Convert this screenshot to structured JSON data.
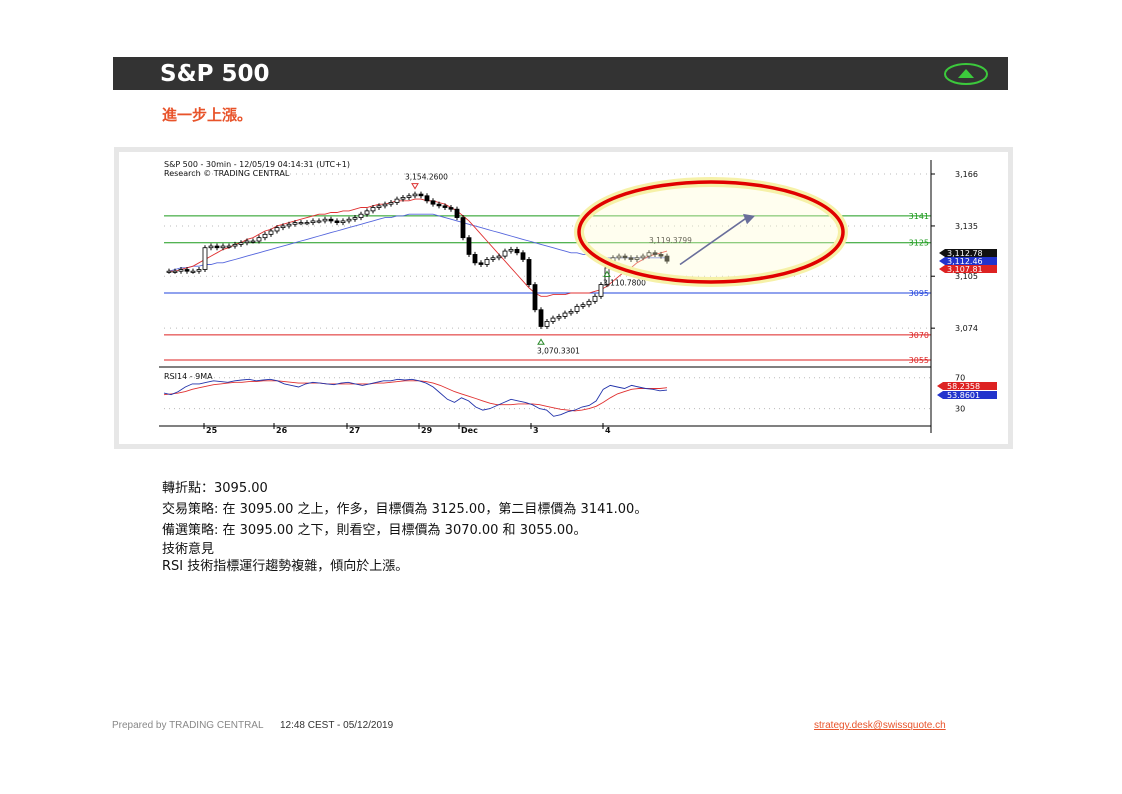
{
  "header": {
    "title": "S&P 500",
    "trend_icon": "up-triangle-icon"
  },
  "subtitle": "進一步上漲。",
  "chart_data": {
    "type": "candlestick",
    "title": "S&P 500 - 30min - 12/05/19 04:14:31 (UTC+1)",
    "subtitle": "Research © TRADING CENTRAL",
    "ylim": [
      3055,
      3166
    ],
    "y_ticks": [
      3166,
      3135,
      3105,
      3074
    ],
    "y_tick_labels": [
      "3,166",
      "3,135",
      "3,105",
      "3,074"
    ],
    "x_tick_labels": [
      "25",
      "26",
      "27",
      "29",
      "Dec",
      "3",
      "4"
    ],
    "levels": [
      {
        "label": "3141",
        "value": 3141,
        "color": "#1a9a1a"
      },
      {
        "label": "3125",
        "value": 3125,
        "color": "#1a9a1a"
      },
      {
        "label": "3095",
        "value": 3095,
        "color": "#2244dd"
      },
      {
        "label": "3070",
        "value": 3070,
        "color": "#dd2222"
      },
      {
        "label": "3055",
        "value": 3055,
        "color": "#dd2222"
      }
    ],
    "annotations": [
      {
        "text": "3,154.2600",
        "value": 3154.26
      },
      {
        "text": "3,110.7800",
        "value": 3110.78
      },
      {
        "text": "3,070.3301",
        "value": 3070.33
      },
      {
        "text": "3,119.3799",
        "value": 3119.38
      }
    ],
    "price_tags": [
      {
        "text": "3,112.78",
        "value": 3112.78,
        "color": "#111111"
      },
      {
        "text": "3,112.46",
        "value": 3112.46,
        "color": "#2233cc"
      },
      {
        "text": "3,107.81",
        "value": 3107.81,
        "color": "#dd2222"
      }
    ],
    "closes": [
      3108,
      3108,
      3109,
      3108,
      3108,
      3109,
      3122,
      3123,
      3122,
      3123,
      3123,
      3124,
      3125,
      3126,
      3126,
      3128,
      3130,
      3132,
      3134,
      3135,
      3136,
      3137,
      3137,
      3137,
      3138,
      3138,
      3139,
      3138,
      3137,
      3138,
      3139,
      3140,
      3142,
      3144,
      3146,
      3147,
      3148,
      3149,
      3151,
      3152,
      3153,
      3154,
      3153,
      3150,
      3148,
      3147,
      3146,
      3145,
      3140,
      3128,
      3118,
      3113,
      3112,
      3115,
      3116,
      3117,
      3120,
      3121,
      3119,
      3115,
      3100,
      3085,
      3075,
      3078,
      3080,
      3081,
      3083,
      3084,
      3087,
      3088,
      3090,
      3093,
      3100,
      3110,
      3116,
      3117,
      3116,
      3115,
      3116,
      3117,
      3119,
      3118,
      3117,
      3114
    ],
    "ma_red": [
      3108,
      3108,
      3109,
      3110,
      3111,
      3113,
      3115,
      3117,
      3119,
      3121,
      3122,
      3124,
      3125,
      3127,
      3128,
      3130,
      3132,
      3133,
      3135,
      3136,
      3137,
      3138,
      3139,
      3140,
      3141,
      3142,
      3142,
      3143,
      3143,
      3144,
      3144,
      3145,
      3146,
      3146,
      3147,
      3148,
      3148,
      3149,
      3150,
      3150,
      3150,
      3151,
      3151,
      3150,
      3150,
      3149,
      3148,
      3146,
      3144,
      3141,
      3138,
      3134,
      3130,
      3126,
      3122,
      3118,
      3114,
      3110,
      3106,
      3102,
      3098,
      3095,
      3093,
      3093,
      3094,
      3094,
      3094,
      3095,
      3095,
      3095,
      3095,
      3096,
      3097,
      3099,
      3102,
      3105,
      3108,
      3110,
      3113,
      3115,
      3117,
      3118,
      3119,
      3120
    ],
    "ma_blue": [
      3108,
      3109,
      3110,
      3110,
      3111,
      3111,
      3112,
      3112,
      3113,
      3113,
      3114,
      3115,
      3116,
      3117,
      3118,
      3119,
      3120,
      3121,
      3122,
      3123,
      3124,
      3125,
      3126,
      3127,
      3128,
      3129,
      3130,
      3131,
      3132,
      3133,
      3134,
      3135,
      3136,
      3137,
      3138,
      3139,
      3140,
      3140,
      3141,
      3141,
      3142,
      3142,
      3142,
      3142,
      3142,
      3141,
      3140,
      3139,
      3138,
      3137,
      3136,
      3135,
      3134,
      3133,
      3132,
      3131,
      3130,
      3129,
      3128,
      3127,
      3126,
      3125,
      3124,
      3123,
      3122,
      3121,
      3120,
      3119,
      3119,
      3118,
      3118,
      3117,
      3117,
      3116,
      3116,
      3116,
      3116,
      3116,
      3116,
      3116,
      3116,
      3116,
      3116,
      3116
    ],
    "rsi": {
      "label": "RSI14 - 9MA",
      "y_tick_labels": [
        "70",
        "30"
      ],
      "tags": [
        {
          "text": "58.2358",
          "color": "#dd2222"
        },
        {
          "text": "53.8601",
          "color": "#2233cc"
        }
      ],
      "rsi_values": [
        50,
        48,
        52,
        58,
        62,
        62,
        64,
        66,
        65,
        64,
        66,
        67,
        68,
        66,
        67,
        68,
        66,
        62,
        60,
        58,
        62,
        64,
        63,
        62,
        61,
        63,
        64,
        62,
        60,
        62,
        64,
        66,
        66,
        68,
        67,
        68,
        66,
        63,
        58,
        50,
        42,
        38,
        44,
        40,
        32,
        28,
        30,
        34,
        38,
        42,
        40,
        38,
        35,
        30,
        28,
        20,
        22,
        26,
        28,
        32,
        34,
        40,
        55,
        60,
        58,
        56,
        60,
        58,
        56,
        55,
        53,
        54
      ],
      "ma_values": [
        48,
        49,
        50,
        52,
        55,
        57,
        59,
        61,
        62,
        63,
        64,
        64,
        65,
        65,
        66,
        66,
        66,
        65,
        64,
        63,
        63,
        63,
        63,
        62,
        62,
        62,
        62,
        62,
        62,
        62,
        63,
        63,
        64,
        65,
        66,
        66,
        66,
        65,
        63,
        60,
        56,
        52,
        49,
        46,
        43,
        40,
        37,
        35,
        35,
        35,
        36,
        36,
        36,
        35,
        33,
        31,
        29,
        28,
        27,
        28,
        30,
        33,
        38,
        44,
        49,
        52,
        55,
        56,
        56,
        56,
        56,
        57
      ]
    }
  },
  "notes": {
    "pivot": "轉折點：3095.00",
    "strategy": "交易策略: 在 3095.00 之上，作多，目標價為  3125.00，第二目標價為  3141.00。",
    "alternative": "備選策略: 在 3095.00 之下，則看空，目標價為  3070.00 和 3055.00。",
    "opinion_title": "技術意見",
    "opinion": "RSI 技術指標運行趨勢複雜，傾向於上漲。"
  },
  "footer": {
    "prepared_by": "Prepared by TRADING CENTRAL",
    "timestamp": "12:48 CEST - 05/12/2019",
    "email": "strategy.desk@swissquote.ch"
  }
}
